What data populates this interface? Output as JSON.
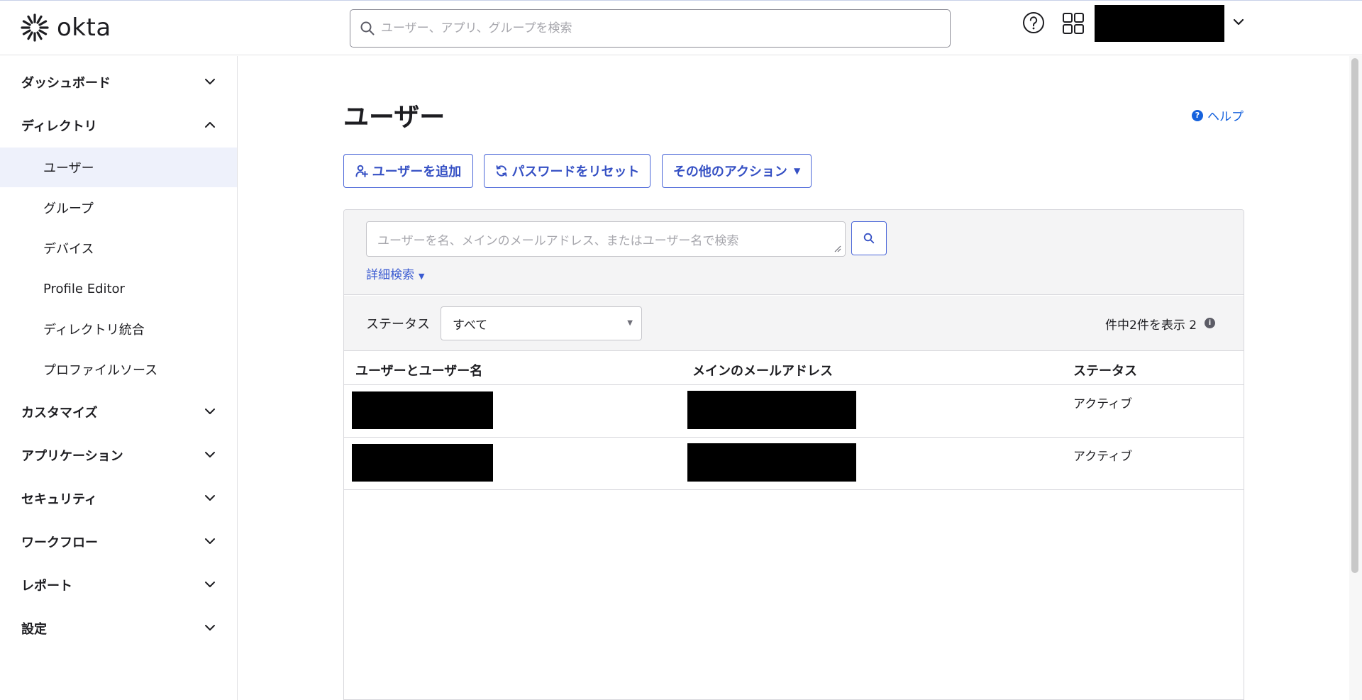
{
  "header": {
    "logo_text": "okta",
    "search_placeholder": "ユーザー、アプリ、グループを検索",
    "icons": [
      "okta-sunburst-logo",
      "search-icon",
      "help-icon",
      "apps-grid-icon",
      "chevron-down-icon"
    ]
  },
  "sidebar": {
    "sections": [
      {
        "label": "ダッシュボード",
        "expanded": false
      },
      {
        "label": "ディレクトリ",
        "expanded": true
      },
      {
        "label": "カスタマイズ",
        "expanded": false
      },
      {
        "label": "アプリケーション",
        "expanded": false
      },
      {
        "label": "セキュリティ",
        "expanded": false
      },
      {
        "label": "ワークフロー",
        "expanded": false
      },
      {
        "label": "レポート",
        "expanded": false
      },
      {
        "label": "設定",
        "expanded": false
      }
    ],
    "directory_items": [
      {
        "label": "ユーザー",
        "active": true
      },
      {
        "label": "グループ",
        "active": false
      },
      {
        "label": "デバイス",
        "active": false
      },
      {
        "label": "Profile Editor",
        "active": false
      },
      {
        "label": "ディレクトリ統合",
        "active": false
      },
      {
        "label": "プロファイルソース",
        "active": false
      }
    ]
  },
  "main": {
    "title": "ユーザー",
    "help_label": "ヘルプ",
    "actions": {
      "add_user": "ユーザーを追加",
      "reset_password": "パスワードをリセット",
      "more_actions": "その他のアクション"
    },
    "search": {
      "placeholder": "ユーザーを名、メインのメールアドレス、またはユーザー名で検索",
      "advanced_label": "詳細検索"
    },
    "filter": {
      "status_label": "ステータス",
      "status_value": "すべて",
      "count_text": "件中2件を表示 2"
    },
    "table": {
      "columns": [
        "ユーザーとユーザー名",
        "メインのメールアドレス",
        "ステータス"
      ],
      "rows": [
        {
          "status": "アクティブ"
        },
        {
          "status": "アクティブ"
        }
      ]
    }
  },
  "colors": {
    "accent": "#3550c4",
    "link": "#1662dd",
    "active_nav_bg": "#eef1fb",
    "panel_bg": "#f4f4f5"
  }
}
